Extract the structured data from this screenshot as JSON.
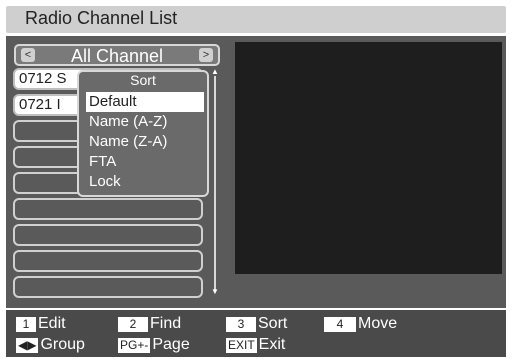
{
  "window": {
    "title": "Radio Channel List"
  },
  "group_bar": {
    "left_arrow": "<",
    "right_arrow": ">",
    "label": "All Channel"
  },
  "channel_list": {
    "rows": [
      {
        "text": "0712 S"
      },
      {
        "text": "0721 I"
      },
      {
        "text": ""
      },
      {
        "text": ""
      },
      {
        "text": ""
      },
      {
        "text": ""
      },
      {
        "text": ""
      },
      {
        "text": ""
      },
      {
        "text": ""
      }
    ]
  },
  "sort_popup": {
    "title": "Sort",
    "options": [
      "Default",
      "Name (A-Z)",
      "Name (Z-A)",
      "FTA",
      "Lock"
    ],
    "selected": "Default"
  },
  "footer": {
    "hints": [
      {
        "key": "1",
        "label": "Edit"
      },
      {
        "key": "2",
        "label": "Find"
      },
      {
        "key": "3",
        "label": "Sort"
      },
      {
        "key": "4",
        "label": "Move"
      },
      {
        "key": "◀▶",
        "label": "Group"
      },
      {
        "key": "PG+-",
        "label": "Page"
      },
      {
        "key": "EXIT",
        "label": "Exit"
      }
    ]
  }
}
